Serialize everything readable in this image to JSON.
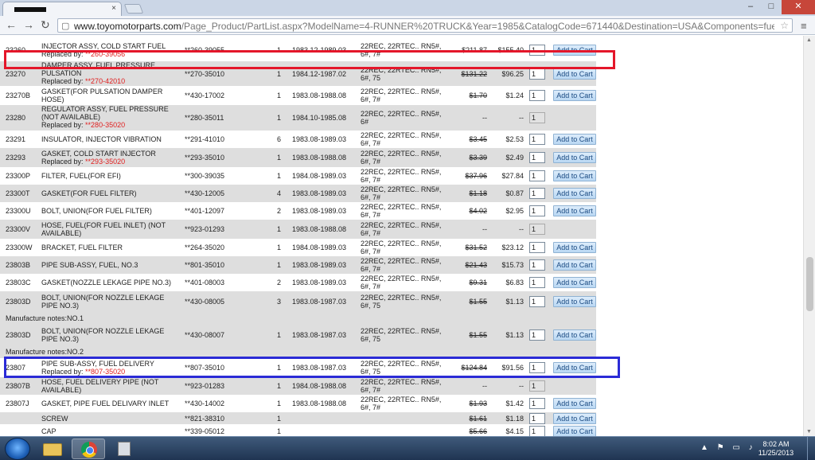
{
  "browser": {
    "tab_close": "×",
    "new_tab": "",
    "url_host": "www.toyomotorparts.com",
    "url_path": "/Page_Product/PartList.aspx?ModelName=4-RUNNER%20TRUCK&Year=1985&CatalogCode=671440&Destination=USA&Components=fuel-in",
    "icons": {
      "back": "←",
      "forward": "→",
      "reload": "↻",
      "page": "▢",
      "star": "☆",
      "menu": "≡",
      "minimize": "–",
      "maximize": "□",
      "close": "✕"
    }
  },
  "cart_label": "Add to Cart",
  "rows": [
    {
      "num": "23260",
      "desc": "INJECTOR ASSY, COLD START FUEL",
      "replaced_label": "Replaced by: ",
      "replaced": "**260-39056",
      "part": "**260-39055",
      "qty": "1",
      "dates": "1983.12-1989.03",
      "eng1": "22REC, 22RTEC.. RN5#,",
      "eng2": "6#, 7#",
      "list": "$211.87",
      "price": "$155.40",
      "order_qty": "1"
    },
    {
      "num": "23270",
      "desc": "DAMPER ASSY, FUEL PRESSURE",
      "desc2": "PULSATION",
      "replaced_label": "Replaced by: ",
      "replaced": "**270-42010",
      "part": "**270-35010",
      "qty": "1",
      "dates": "1984.12-1987.02",
      "eng1": "22REC, 22RTEC.. RN5#,",
      "eng2": "6#, 75",
      "list": "$131.22",
      "price": "$96.25",
      "order_qty": "1"
    },
    {
      "num": "23270B",
      "desc": "GASKET(FOR PULSATION DAMPER",
      "desc2": "HOSE)",
      "part": "**430-17002",
      "qty": "1",
      "dates": "1983.08-1988.08",
      "eng1": "22REC, 22RTEC.. RN5#,",
      "eng2": "6#, 7#",
      "list": "$1.70",
      "price": "$1.24",
      "order_qty": "1"
    },
    {
      "num": "23280",
      "desc": "REGULATOR ASSY, FUEL PRESSURE",
      "desc2": "(NOT AVAILABLE)",
      "replaced_label": "Replaced by: ",
      "replaced": "**280-35020",
      "part": "**280-35011",
      "qty": "1",
      "dates": "1984.10-1985.08",
      "eng1": "22REC, 22RTEC.. RN5#,",
      "eng2": "6#",
      "list": "--",
      "price": "--",
      "order_qty": "1"
    },
    {
      "num": "23291",
      "desc": "INSULATOR, INJECTOR VIBRATION",
      "part": "**291-41010",
      "qty": "6",
      "dates": "1983.08-1989.03",
      "eng1": "22REC, 22RTEC.. RN5#,",
      "eng2": "6#, 7#",
      "list": "$3.45",
      "price": "$2.53",
      "order_qty": "1"
    },
    {
      "num": "23293",
      "desc": "GASKET, COLD START INJECTOR",
      "replaced_label": "Replaced by: ",
      "replaced": "**293-35020",
      "part": "**293-35010",
      "qty": "1",
      "dates": "1983.08-1988.08",
      "eng1": "22REC, 22RTEC.. RN5#,",
      "eng2": "6#, 7#",
      "list": "$3.39",
      "price": "$2.49",
      "order_qty": "1"
    },
    {
      "num": "23300P",
      "desc": "FILTER, FUEL(FOR EFI)",
      "part": "**300-39035",
      "qty": "1",
      "dates": "1984.08-1989.03",
      "eng1": "22REC, 22RTEC.. RN5#,",
      "eng2": "6#, 7#",
      "list": "$37.96",
      "price": "$27.84",
      "order_qty": "1"
    },
    {
      "num": "23300T",
      "desc": "GASKET(FOR FUEL FILTER)",
      "part": "**430-12005",
      "qty": "4",
      "dates": "1983.08-1989.03",
      "eng1": "22REC, 22RTEC.. RN5#,",
      "eng2": "6#, 7#",
      "list": "$1.18",
      "price": "$0.87",
      "order_qty": "1"
    },
    {
      "num": "23300U",
      "desc": "BOLT, UNION(FOR FUEL FILTER)",
      "part": "**401-12097",
      "qty": "2",
      "dates": "1983.08-1989.03",
      "eng1": "22REC, 22RTEC.. RN5#,",
      "eng2": "6#, 7#",
      "list": "$4.02",
      "price": "$2.95",
      "order_qty": "1"
    },
    {
      "num": "23300V",
      "desc": "HOSE, FUEL(FOR FUEL INLET) (NOT",
      "desc2": "AVAILABLE)",
      "part": "**923-01293",
      "qty": "1",
      "dates": "1983.08-1988.08",
      "eng1": "22REC, 22RTEC.. RN5#,",
      "eng2": "6#, 7#",
      "list": "--",
      "price": "--",
      "order_qty": "1"
    },
    {
      "num": "23300W",
      "desc": "BRACKET, FUEL FILTER",
      "part": "**264-35020",
      "qty": "1",
      "dates": "1984.08-1989.03",
      "eng1": "22REC, 22RTEC.. RN5#,",
      "eng2": "6#, 7#",
      "list": "$31.52",
      "price": "$23.12",
      "order_qty": "1"
    },
    {
      "num": "23803B",
      "desc": "PIPE SUB-ASSY, FUEL, NO.3",
      "part": "**801-35010",
      "qty": "1",
      "dates": "1983.08-1989.03",
      "eng1": "22REC, 22RTEC.. RN5#,",
      "eng2": "6#, 7#",
      "list": "$21.43",
      "price": "$15.73",
      "order_qty": "1"
    },
    {
      "num": "23803C",
      "desc": "GASKET(NOZZLE LEKAGE PIPE NO.3)",
      "part": "**401-08003",
      "qty": "2",
      "dates": "1983.08-1989.03",
      "eng1": "22REC, 22RTEC.. RN5#,",
      "eng2": "6#, 7#",
      "list": "$9.31",
      "price": "$6.83",
      "order_qty": "1"
    },
    {
      "num": "23803D",
      "desc": "BOLT, UNION(FOR NOZZLE LEKAGE",
      "desc2": "PIPE NO.3)",
      "part": "**430-08005",
      "qty": "3",
      "dates": "1983.08-1987.03",
      "eng1": "22REC, 22RTEC.. RN5#,",
      "eng2": "6#, 75",
      "list": "$1.55",
      "price": "$1.13",
      "order_qty": "1"
    },
    {
      "num": "23803D",
      "desc": "BOLT, UNION(FOR NOZZLE LEKAGE",
      "desc2": "PIPE NO.3)",
      "part": "**430-08007",
      "qty": "1",
      "dates": "1983.08-1987.03",
      "eng1": "22REC, 22RTEC.. RN5#,",
      "eng2": "6#, 75",
      "list": "$1.55",
      "price": "$1.13",
      "order_qty": "1"
    },
    {
      "num": "23807",
      "desc": "PIPE SUB-ASSY, FUEL DELIVERY",
      "replaced_label": "Replaced by: ",
      "replaced": "**807-35020",
      "part": "**807-35010",
      "qty": "1",
      "dates": "1983.08-1987.03",
      "eng1": "22REC, 22RTEC.. RN5#,",
      "eng2": "6#, 75",
      "list": "$124.84",
      "price": "$91.56",
      "order_qty": "1"
    },
    {
      "num": "23807B",
      "desc": "HOSE, FUEL DELIVERY PIPE (NOT",
      "desc2": "AVAILABLE)",
      "part": "**923-01283",
      "qty": "1",
      "dates": "1984.08-1988.08",
      "eng1": "22REC, 22RTEC.. RN5#,",
      "eng2": "6#, 7#",
      "list": "--",
      "price": "--",
      "order_qty": "1"
    },
    {
      "num": "23807J",
      "desc": "GASKET, PIPE FUEL DELIVARY INLET",
      "part": "**430-14002",
      "qty": "1",
      "dates": "1983.08-1988.08",
      "eng1": "22REC, 22RTEC.. RN5#,",
      "eng2": "6#, 7#",
      "list": "$1.93",
      "price": "$1.42",
      "order_qty": "1"
    },
    {
      "num": "",
      "desc": "SCREW",
      "part": "**821-38310",
      "qty": "1",
      "dates": "",
      "eng1": "",
      "eng2": "",
      "list": "$1.61",
      "price": "$1.18",
      "order_qty": "1"
    },
    {
      "num": "",
      "desc": "CAP",
      "part": "**339-05012",
      "qty": "1",
      "dates": "",
      "eng1": "",
      "eng2": "",
      "list": "$5.66",
      "price": "$4.15",
      "order_qty": "1"
    }
  ],
  "notes": [
    "Manufacture notes:NO.1",
    "Manufacture notes:NO.2"
  ],
  "taskbar": {
    "tray_icons": "▲ ⚑ ▭ ♪",
    "time": "8:02 AM",
    "date": "11/25/2013"
  }
}
